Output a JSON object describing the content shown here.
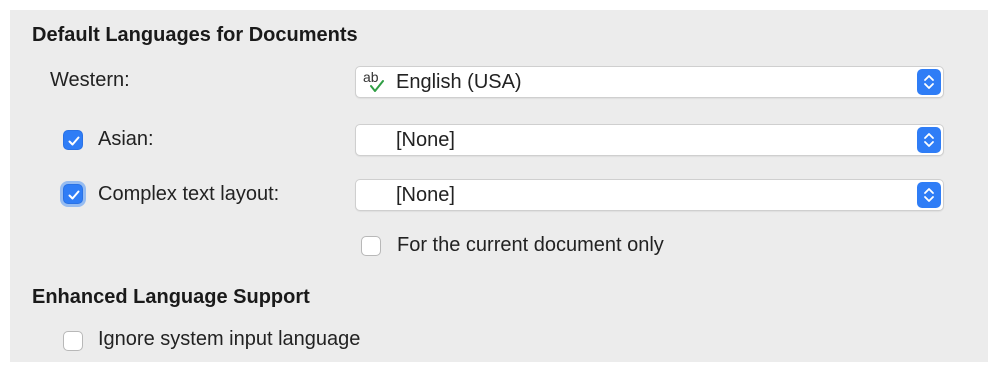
{
  "default_languages": {
    "title": "Default Languages for Documents",
    "western": {
      "label": "Western:",
      "value": "English (USA)",
      "icon": "spellcheck-icon"
    },
    "asian": {
      "label": "Asian:",
      "checked": true,
      "value": "[None]"
    },
    "ctl": {
      "label": "Complex text layout:",
      "checked": true,
      "value": "[None]"
    },
    "current_document_only": {
      "label": "For the current document only",
      "checked": false
    }
  },
  "enhanced_language": {
    "title": "Enhanced Language Support",
    "ignore_system_input": {
      "label": "Ignore system input language",
      "checked": false
    }
  },
  "colors": {
    "accent": "#2f7df6",
    "panel_background": "#ececec"
  }
}
